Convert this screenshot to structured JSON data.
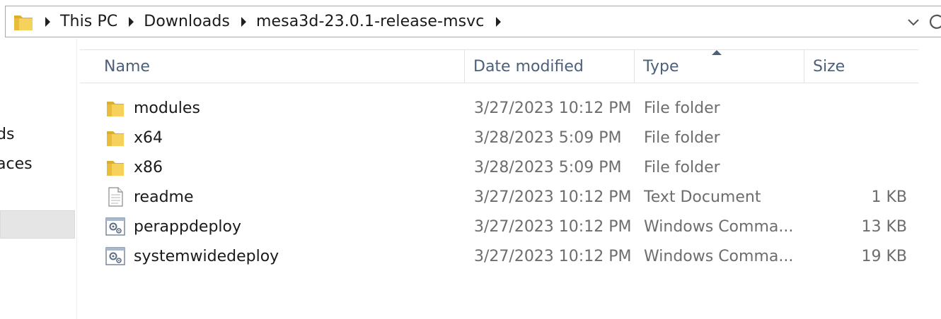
{
  "address_bar": {
    "crumbs": [
      "This PC",
      "Downloads",
      "mesa3d-23.0.1-release-msvc"
    ],
    "icon": "folder-icon",
    "dropdown_icon": "chevron-down-icon",
    "refresh_icon": "refresh-icon"
  },
  "nav_pane": {
    "items": [
      "ds",
      "aces"
    ]
  },
  "columns": {
    "name": "Name",
    "date": "Date modified",
    "type": "Type",
    "size": "Size",
    "sorted_by": "type",
    "sort_direction": "ascending"
  },
  "files": [
    {
      "name": "modules",
      "date": "3/27/2023 10:12 PM",
      "type": "File folder",
      "size": "",
      "icon": "folder-icon"
    },
    {
      "name": "x64",
      "date": "3/28/2023 5:09 PM",
      "type": "File folder",
      "size": "",
      "icon": "folder-icon"
    },
    {
      "name": "x86",
      "date": "3/28/2023 5:09 PM",
      "type": "File folder",
      "size": "",
      "icon": "folder-icon"
    },
    {
      "name": "readme",
      "date": "3/27/2023 10:12 PM",
      "type": "Text Document",
      "size": "1 KB",
      "icon": "text-document-icon"
    },
    {
      "name": "perappdeploy",
      "date": "3/27/2023 10:12 PM",
      "type": "Windows Comma...",
      "size": "13 KB",
      "icon": "command-script-icon"
    },
    {
      "name": "systemwidedeploy",
      "date": "3/27/2023 10:12 PM",
      "type": "Windows Comma...",
      "size": "19 KB",
      "icon": "command-script-icon"
    }
  ],
  "colors": {
    "header_text": "#4c607a",
    "detail_text": "#6d6d6d",
    "folder_yellow": "#f3c640"
  }
}
